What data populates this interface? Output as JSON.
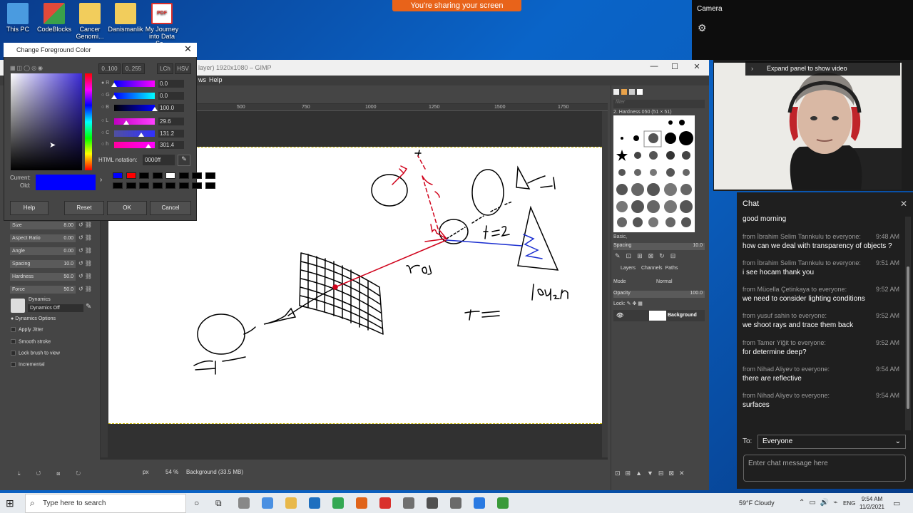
{
  "desktop": {
    "icons": [
      {
        "label": "This PC",
        "color": "#4a9be0"
      },
      {
        "label": "CodeBlocks",
        "color": "#e04a3a"
      },
      {
        "label": "Cancer Genomi...",
        "color": "#f2cd5c"
      },
      {
        "label": "Danismanlik",
        "color": "#f2cd5c"
      },
      {
        "label": "My Journey into Data Sc...",
        "color": "#d9302c"
      }
    ]
  },
  "share_banner": "You're sharing your screen",
  "camera": {
    "title": "Camera",
    "expand_label": "Expand panel to show video"
  },
  "chat": {
    "title": "Chat",
    "first_message": "good morning",
    "messages": [
      {
        "from": "from İbrahim Selim Tannkulu to everyone:",
        "time": "9:48 AM",
        "text": "how can we deal with transparency of objects ?"
      },
      {
        "from": "from İbrahim Selim Tannkulu to everyone:",
        "time": "9:51 AM",
        "text": "i see hocam thank you"
      },
      {
        "from": "from Mücella Çetinkaya to everyone:",
        "time": "9:52 AM",
        "text": "we need to consider lighting conditions"
      },
      {
        "from": "from yusuf sahin to everyone:",
        "time": "9:52 AM",
        "text": "we shoot rays and trace them back"
      },
      {
        "from": "from Tamer Yiğit to everyone:",
        "time": "9:52 AM",
        "text": "for determine deep?"
      },
      {
        "from": "from Nihad Aliyev to everyone:",
        "time": "9:54 AM",
        "text": "there are reflective"
      },
      {
        "from": "from Nihad Aliyev to everyone:",
        "time": "9:54 AM",
        "text": "surfaces"
      }
    ],
    "to_label": "To:",
    "to_value": "Everyone",
    "input_placeholder": "Enter chat message here"
  },
  "gimp": {
    "title": "layer) 1920x1080 – GIMP",
    "menu": [
      "ws",
      "Help"
    ],
    "ruler_labels": [
      "500",
      "750",
      "1000",
      "1250",
      "1500",
      "1750"
    ],
    "status": {
      "unit": "px",
      "zoom": "54 %",
      "layer_info": "Background (33.5 MB)"
    },
    "tool_options": [
      {
        "label": "Size",
        "value": "8.00"
      },
      {
        "label": "Aspect Ratio",
        "value": "0.00"
      },
      {
        "label": "Angle",
        "value": "0.00"
      },
      {
        "label": "Spacing",
        "value": "10.0"
      },
      {
        "label": "Hardness",
        "value": "50.0"
      },
      {
        "label": "Force",
        "value": "50.0"
      }
    ],
    "dynamics_label": "Dynamics",
    "dynamics_value": "Dynamics Off",
    "dynamics_options": "Dynamics Options",
    "checkboxes": [
      "Apply Jitter",
      "Smooth stroke",
      "Lock brush to view",
      "Incremental"
    ],
    "dock": {
      "filter_placeholder": "filter",
      "brush_name": "2. Hardness 050 (51 × 51)",
      "brush_set": "Basic,",
      "spacing_label": "Spacing",
      "spacing_value": "10.0",
      "tabs": [
        "Layers",
        "Channels",
        "Paths"
      ],
      "mode_label": "Mode",
      "mode_value": "Normal",
      "opacity_label": "Opacity",
      "opacity_value": "100.0",
      "lock_label": "Lock:",
      "layer_name": "Background"
    }
  },
  "color_dialog": {
    "title": "Change Foreground Color",
    "range_buttons": [
      "0..100",
      "0..255"
    ],
    "mode_buttons": [
      "LCh",
      "HSV"
    ],
    "channels": [
      {
        "label": "R",
        "value": "0.0",
        "level": 0.0,
        "gradient": "linear-gradient(to right,#0000ff,#ff00ff)"
      },
      {
        "label": "G",
        "value": "0.0",
        "level": 0.0,
        "gradient": "linear-gradient(to right,#0000ff,#00ffff)"
      },
      {
        "label": "B",
        "value": "100.0",
        "level": 1.0,
        "gradient": "linear-gradient(to right,#000000,#0000ff)"
      },
      {
        "label": "L",
        "value": "29.6",
        "level": 0.3,
        "gradient": "linear-gradient(to right,#c000c0,#ff40ff)"
      },
      {
        "label": "C",
        "value": "131.2",
        "level": 0.66,
        "gradient": "linear-gradient(to right,#5050a0,#3030ff)"
      },
      {
        "label": "h",
        "value": "301.4",
        "level": 0.84,
        "gradient": "linear-gradient(to right,#ff00a0,#ff00ff)"
      }
    ],
    "html_notation_label": "HTML notation:",
    "html_notation_value": "0000ff",
    "current_label": "Current:",
    "old_label": "Old:",
    "history_colors": [
      "#0000ff",
      "#ff0000",
      "#000000",
      "#000000",
      "#ffffff",
      "#000000",
      "#000000",
      "#000000",
      "#000000",
      "#000000",
      "#000000",
      "#000000",
      "#000000",
      "#000000",
      "#000000",
      "#000000"
    ],
    "buttons": [
      "Help",
      "Reset",
      "OK",
      "Cancel"
    ]
  },
  "taskbar": {
    "search_placeholder": "Type here to search",
    "apps": [
      "#888888",
      "#4a90e2",
      "#e8b84a",
      "#1e6fbf",
      "#34a853",
      "#e0641a",
      "#d9302c",
      "#707070",
      "#505050",
      "#6a6a6a",
      "#2a7ae2",
      "#3a9a3a"
    ],
    "weather": "59°F  Cloudy",
    "lang": "ENG",
    "time": "9:54 AM",
    "date": "11/2/2021"
  }
}
